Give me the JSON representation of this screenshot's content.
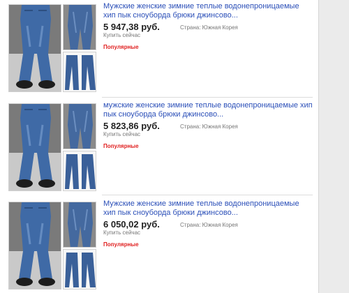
{
  "listings": [
    {
      "title": "Мужские женские зимние теплые водонепроницаемые хип пык сноуборда брюки джинсово...",
      "price": "5 947,38 руб.",
      "buy_label": "Купить сейчас",
      "country": "Страна: Южная Корея",
      "badge": "Популярные"
    },
    {
      "title": "мужские женские зимние теплые водонепроницаемые хип пык сноуборда брюки джинсово...",
      "price": "5 823,86 руб.",
      "buy_label": "Купить сейчас",
      "country": "Страна: Южная Корея",
      "badge": "Популярные"
    },
    {
      "title": "Мужские женские зимние теплые водонепроницаемые хип пык сноуборда брюки джинсово...",
      "price": "6 050,02 руб.",
      "buy_label": "Купить сейчас",
      "country": "Страна: Южная Корея",
      "badge": "Популярные"
    }
  ],
  "colors": {
    "link": "#2b4fb8",
    "badge": "#e02020",
    "denim": "#3f6aa6"
  },
  "icons": {
    "main_image": "jeans-photo-model",
    "side_top": "jeans-photo-closeup",
    "side_bottom": "jeans-photo-flat"
  }
}
